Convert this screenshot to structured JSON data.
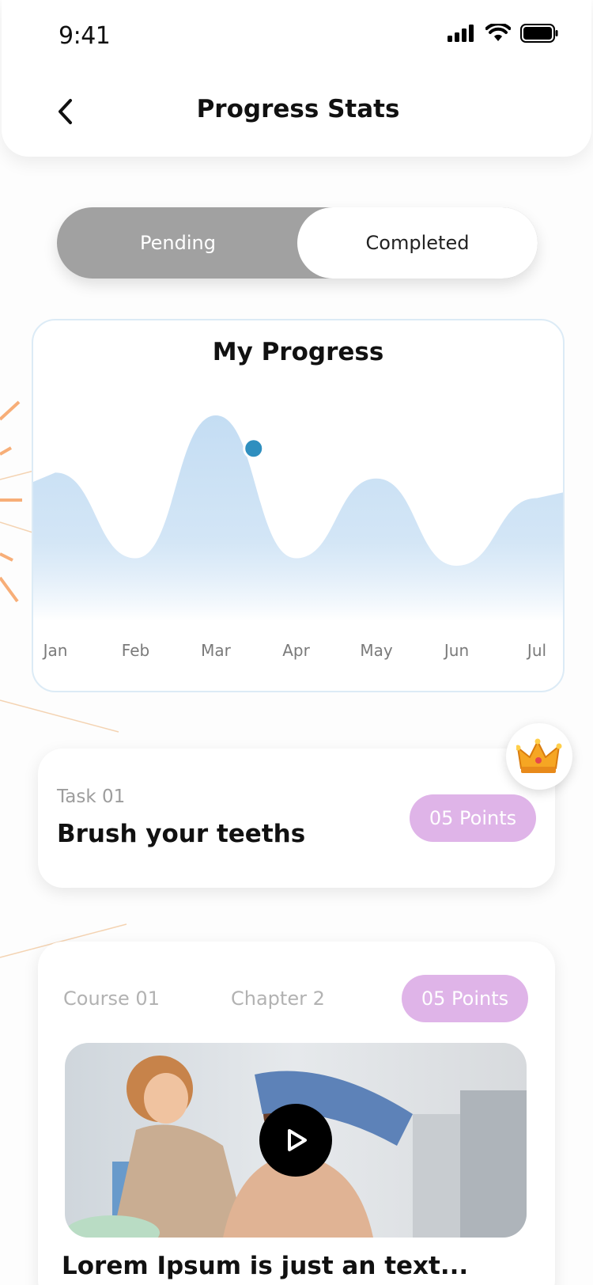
{
  "status_bar": {
    "time": "9:41"
  },
  "header": {
    "title": "Progress Stats"
  },
  "tabs": [
    {
      "label": "Pending",
      "state": "inactive"
    },
    {
      "label": "Completed",
      "state": "selected"
    }
  ],
  "progress_card": {
    "title": "My Progress",
    "chart_data": {
      "type": "area",
      "x": [
        "Jan",
        "Feb",
        "Mar",
        "Apr",
        "May",
        "Jun",
        "Jul"
      ],
      "values": [
        0.62,
        0.05,
        1.0,
        0.05,
        0.58,
        0.0,
        0.45
      ],
      "highlight_point": {
        "x": "Mar–Apr",
        "value": 0.78
      },
      "color": "#c4ddf3",
      "point_color": "#2f8fbf",
      "grid": false
    }
  },
  "task_card": {
    "label": "Task 01",
    "title": "Brush your teeths",
    "points": "05 Points",
    "badge_icon": "crown-icon"
  },
  "course_card": {
    "course": "Course 01",
    "chapter": "Chapter 2",
    "points": "05 Points",
    "title": "Lorem Ipsum is just an text...",
    "media_icon": "play-icon"
  },
  "colors": {
    "accent_badge": "#dfb4e8",
    "segmented_inactive": "#a1a1a1",
    "chart_fill": "#c4ddf3"
  }
}
